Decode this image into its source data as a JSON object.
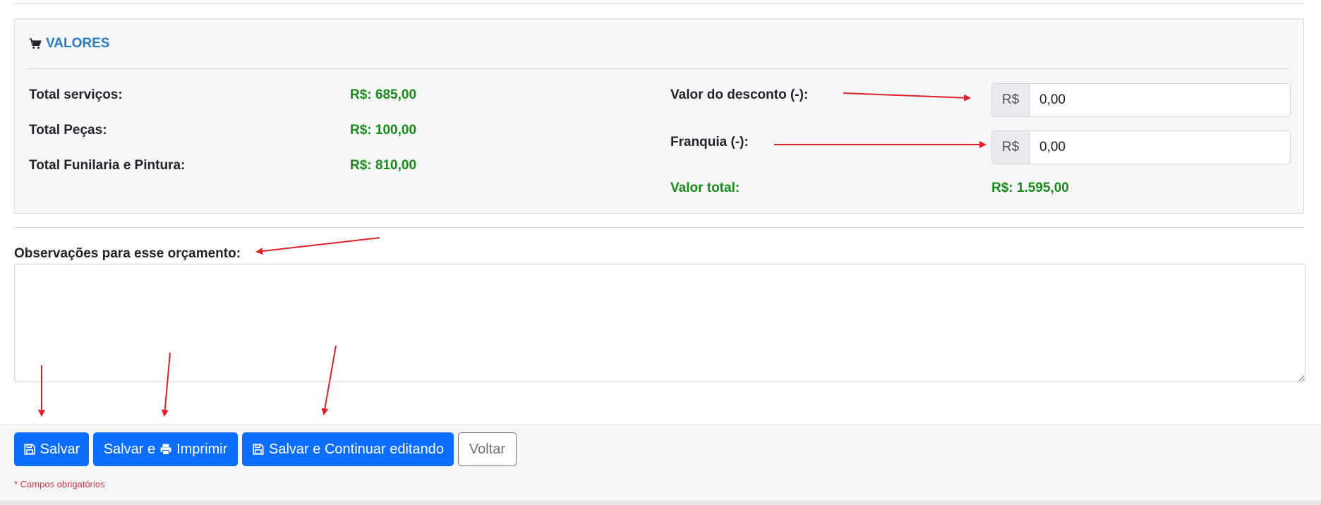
{
  "values_card": {
    "title": "VALORES",
    "icon": "shopping-cart-icon",
    "rows": [
      {
        "label": "Total serviços:",
        "value": "R$: 685,00"
      },
      {
        "label": "Total Peças:",
        "value": "R$: 100,00"
      },
      {
        "label": "Total Funilaria e Pintura:",
        "value": "R$: 810,00"
      }
    ],
    "discount": {
      "label": "Valor do desconto (-):",
      "prefix": "R$",
      "value": "0,00"
    },
    "franchise": {
      "label": "Franquia (-):",
      "prefix": "R$",
      "value": "0,00"
    },
    "total": {
      "label": "Valor total:",
      "value": "R$: 1.595,00"
    }
  },
  "observations": {
    "label": "Observações para esse orçamento:",
    "value": ""
  },
  "footer": {
    "save_label": "Salvar",
    "save_print_label_1": "Salvar e",
    "save_print_label_2": "Imprimir",
    "save_continue_label": "Salvar e Continuar editando",
    "back_label": "Voltar",
    "required_note": "* Campos obrigatórios"
  },
  "colors": {
    "accent": "#0d6efd",
    "header_blue": "#2a7bc0",
    "money_green": "#1a8a1a",
    "annotation_red": "#e0202a",
    "required_red": "#dc3545"
  }
}
